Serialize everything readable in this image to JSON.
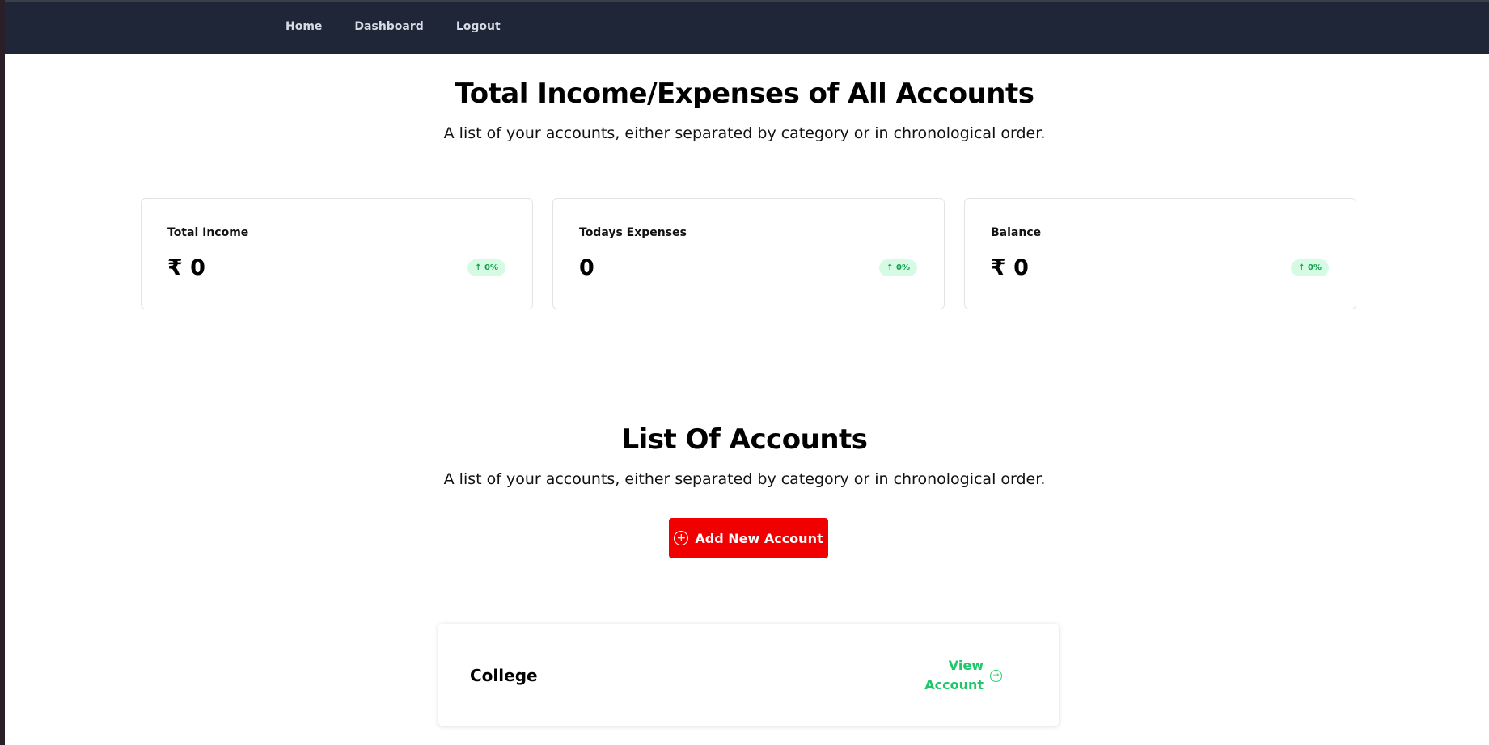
{
  "nav": {
    "links": [
      "Home",
      "Dashboard",
      "Logout"
    ]
  },
  "summary": {
    "title": "Total Income/Expenses of All Accounts",
    "subtitle": "A list of your accounts, either separated by category or in chronological order.",
    "cards": [
      {
        "label": "Total Income",
        "value": "₹ 0",
        "badge": "↑ 0%"
      },
      {
        "label": "Todays Expenses",
        "value": "0",
        "badge": "↑ 0%"
      },
      {
        "label": "Balance",
        "value": "₹ 0",
        "badge": "↑ 0%"
      }
    ]
  },
  "accounts": {
    "title": "List Of Accounts",
    "subtitle": "A list of your accounts, either separated by category or in chronological order.",
    "add_button_label": "Add New Account",
    "items": [
      {
        "name": "College",
        "link_label": "View Account"
      }
    ]
  },
  "colors": {
    "navbar": "#1f2637",
    "accent_red": "#f00000",
    "accent_green": "#1ec86a",
    "badge_bg": "#d6fbe5"
  },
  "icons": {
    "add": "plus-circle-icon",
    "view": "arrow-right-circle-icon",
    "trend": "arrow-up-icon"
  }
}
